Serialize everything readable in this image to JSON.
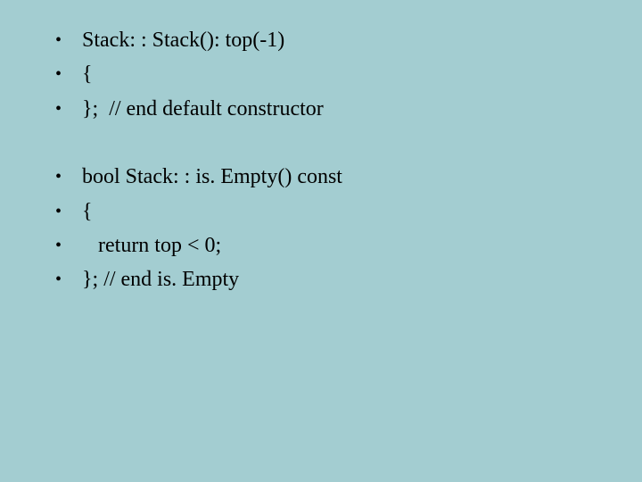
{
  "lines": {
    "l1": "Stack: : Stack(): top(-1)",
    "l2": "{",
    "l3": "};  // end default constructor",
    "l4": "bool Stack: : is. Empty() const",
    "l5": "{",
    "l6": "   return top < 0;",
    "l7": "}; // end is. Empty"
  }
}
